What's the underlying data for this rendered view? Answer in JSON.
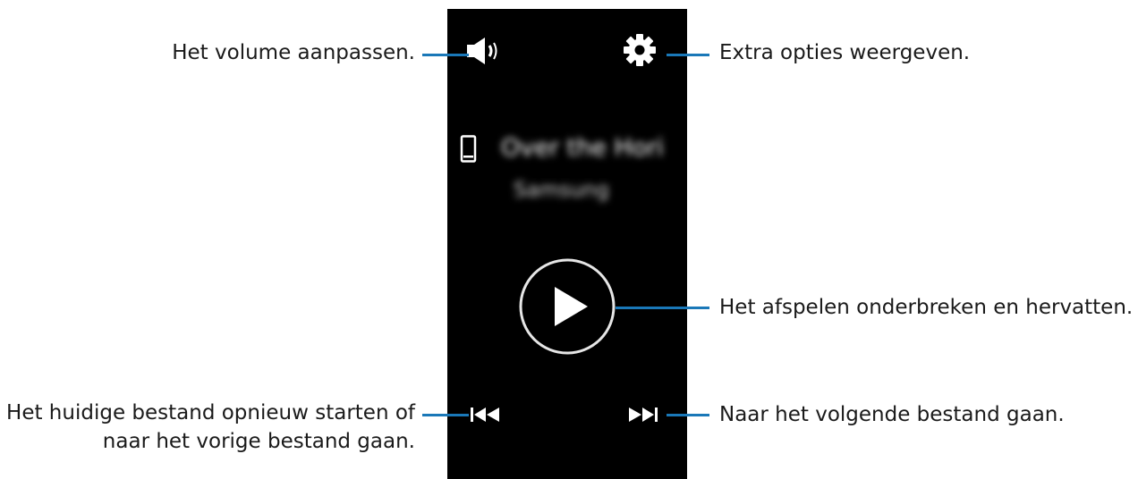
{
  "callouts": {
    "volume": "Het volume aanpassen.",
    "options": "Extra opties weergeven.",
    "play_pause": "Het afspelen onderbreken en hervatten.",
    "previous_line1": "Het huidige bestand opnieuw starten of",
    "previous_line2": "naar het vorige bestand gaan.",
    "next": "Naar het volgende bestand gaan."
  },
  "player": {
    "track_title": "Over the Hori",
    "artist": "Samsung"
  },
  "icons": {
    "volume": "volume-icon",
    "settings": "gear-icon",
    "device": "phone-icon",
    "play": "play-icon",
    "previous": "previous-track-icon",
    "next": "next-track-icon"
  },
  "colors": {
    "leader": "#1a78b8",
    "screen": "#000000",
    "icon": "#ffffff"
  }
}
